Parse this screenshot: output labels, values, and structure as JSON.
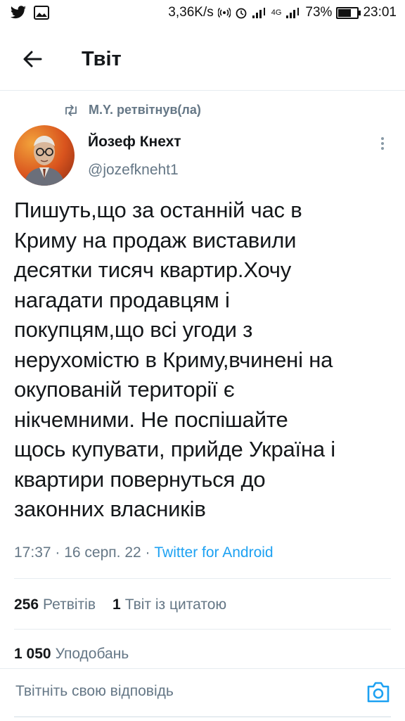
{
  "statusbar": {
    "speed": "3,36K/s",
    "network": "4G",
    "battery": "73%",
    "battery_level": 0.73,
    "time": "23:01"
  },
  "header": {
    "title": "Твіт"
  },
  "retweet": {
    "text": "M.Y. ретвітнув(ла)"
  },
  "author": {
    "name": "Йозеф Кнехт",
    "handle": "@jozefkneht1"
  },
  "tweet": {
    "lines": [
      "Пишуть,що за останній час в",
      "Криму на продаж виставили",
      "десятки тисяч квартир.Хочу",
      "нагадати продавцям і",
      "покупцям,що всі угоди з",
      "нерухомістю в Криму,вчинені на",
      "окупованій території є",
      "нікчемними. Не поспішайте",
      "щось купувати, прийде Україна і",
      "квартири повернуться до",
      "законних власників"
    ],
    "time": "17:37",
    "date": "16 серп. 22",
    "source": "Twitter for Android"
  },
  "stats": {
    "retweets_count": "256",
    "retweets_label": "Ретвітів",
    "quotes_count": "1",
    "quotes_label": "Твіт із цитатою",
    "likes_count": "1 050",
    "likes_label": "Уподобань"
  },
  "reply": {
    "placeholder": "Твітніть свою відповідь"
  },
  "icons": {
    "back": "arrow-left-icon",
    "retweet": "retweet-icon",
    "more": "vertical-dots-icon",
    "camera": "camera-icon"
  },
  "colors": {
    "accent": "#1da1f2",
    "muted": "#657786"
  }
}
